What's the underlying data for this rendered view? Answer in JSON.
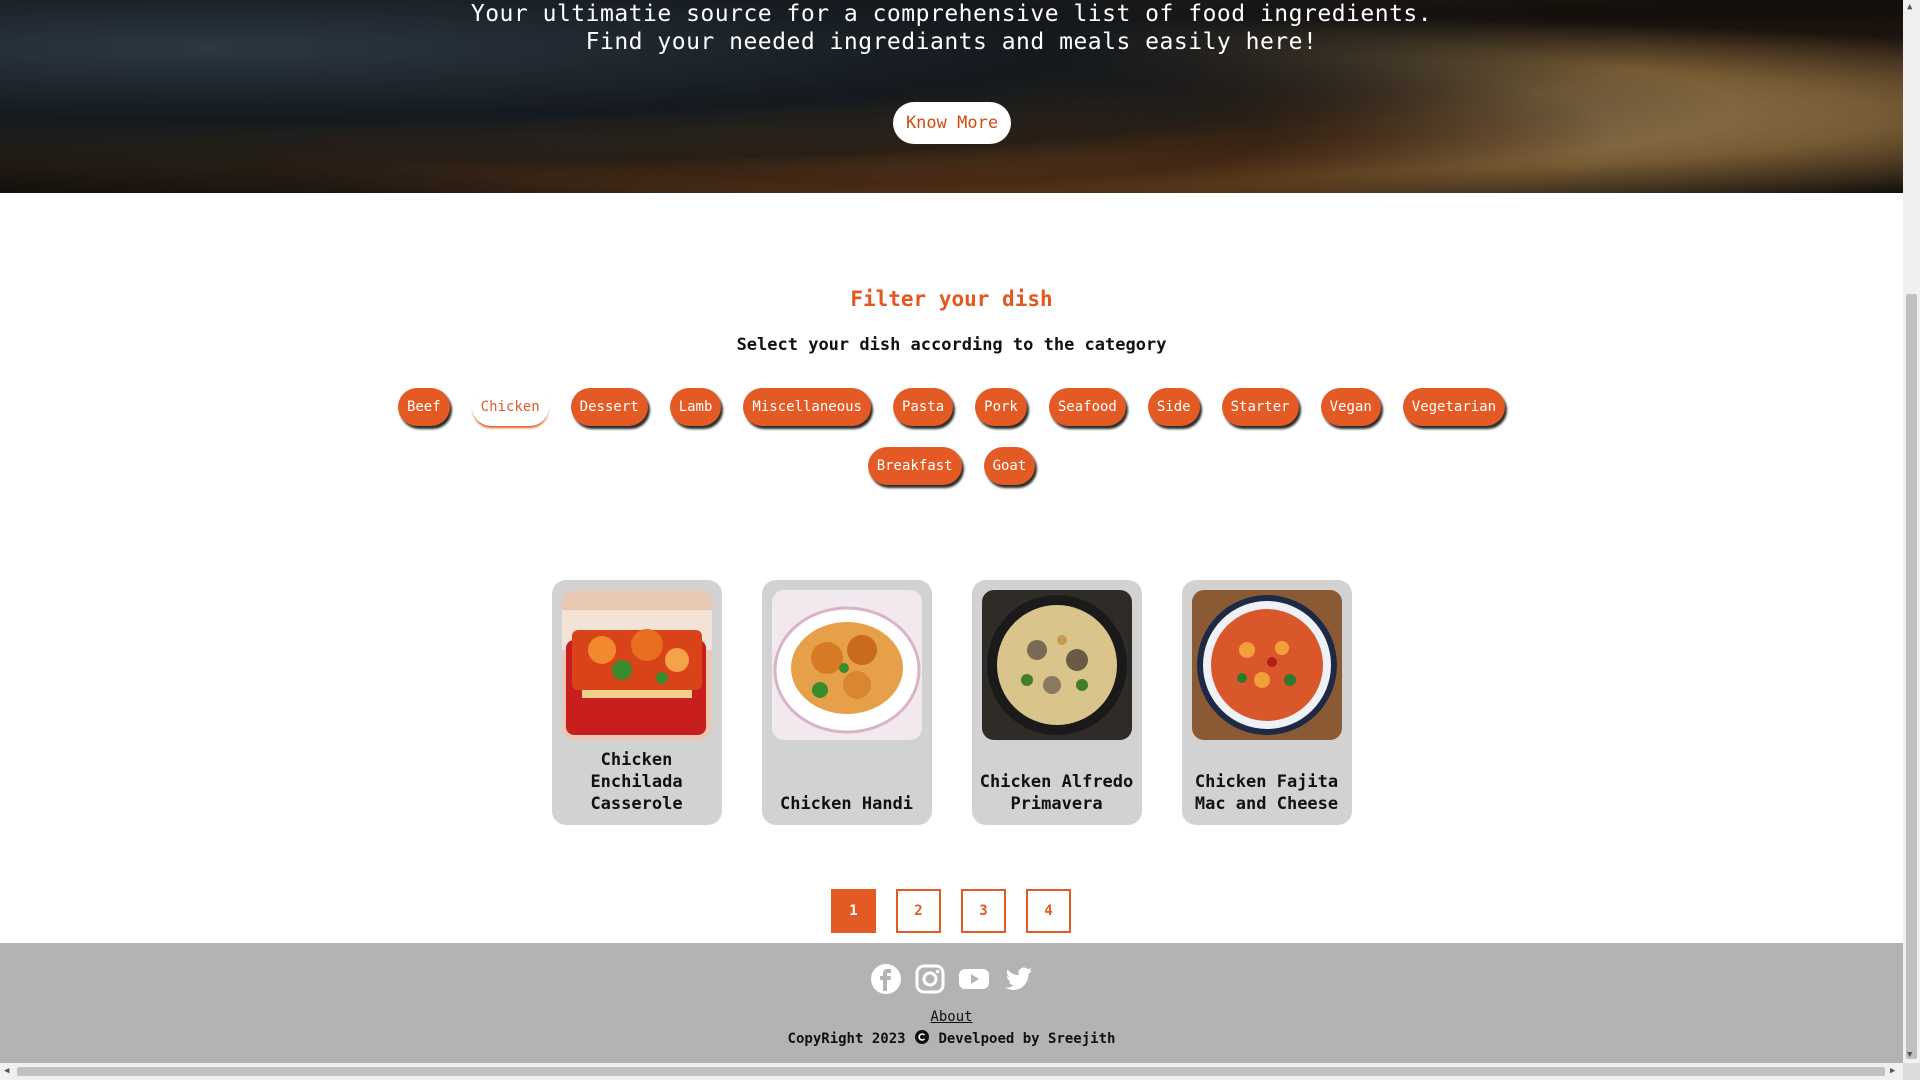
{
  "hero": {
    "line1": "Your ultimatie source for a comprehensive list of food ingredients.",
    "line2": "Find your needed ingrediants and meals easily here!",
    "button": "Know More"
  },
  "filter": {
    "title": "Filter your dish",
    "subtitle": "Select your dish according to the category",
    "categories_row1": [
      "Beef",
      "Chicken",
      "Dessert",
      "Lamb",
      "Miscellaneous",
      "Pasta",
      "Pork",
      "Seafood",
      "Side",
      "Starter",
      "Vegan",
      "Vegetarian"
    ],
    "categories_row2": [
      "Breakfast",
      "Goat"
    ],
    "active": "Chicken"
  },
  "cards": [
    {
      "name": "Chicken Enchilada Casserole"
    },
    {
      "name": "Chicken Handi"
    },
    {
      "name": "Chicken Alfredo Primavera"
    },
    {
      "name": "Chicken Fajita Mac and Cheese"
    }
  ],
  "pagination": {
    "pages": [
      "1",
      "2",
      "3",
      "4"
    ],
    "active": "1"
  },
  "footer": {
    "socials": [
      "facebook-icon",
      "instagram-icon",
      "youtube-icon",
      "twitter-icon"
    ],
    "about": "About",
    "copyright_left": "CopyRight 2023",
    "copyright_right": "Develpoed by Sreejith"
  },
  "colors": {
    "accent": "#e35a24",
    "footer_bg": "#b3b3b3",
    "card_bg": "#d2d2d2"
  }
}
